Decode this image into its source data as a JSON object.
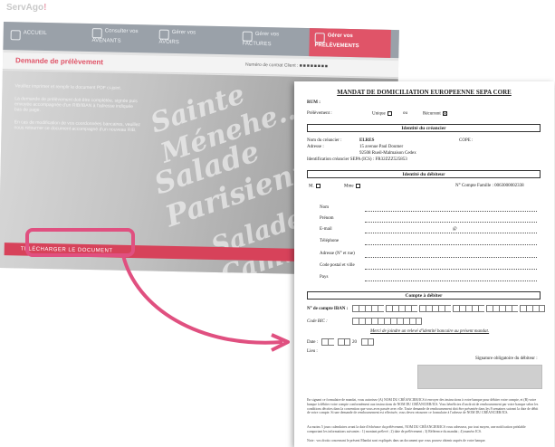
{
  "logo": {
    "text_left": "ServAgo",
    "text_accent": "!"
  },
  "app": {
    "nav": [
      {
        "label": "ACCUEIL",
        "icon": "home-icon"
      },
      {
        "label": "Consulter vos\nAVENANTS",
        "icon": "document-icon"
      },
      {
        "label": "Gérer vos\nAVOIRS",
        "icon": "list-icon"
      },
      {
        "label": "Gérer vos\nFACTURES",
        "icon": "invoice-icon"
      },
      {
        "label": "Gérer vos\nPRÉLÈVEMENTS",
        "icon": "card-icon",
        "active": true
      }
    ],
    "page_title": "Demande de prélèvement",
    "contract_label": "Numéro de contrat Client :",
    "contract_value": "■■■■■■■■",
    "content_lines": [
      "Veuillez imprimer et remplir le document PDF ci-joint.",
      "La demande de prélèvement doit être complétée, signée puis\nenvoyée accompagnée d'un RIB/IBAN à l'adresse indiquée\nbas de page.",
      "En cas de modification de vos coordonnées bancaires, veuillez\nnous retourner ce document accompagné d'un nouveau RIB."
    ],
    "brand_words": [
      "Sainte Ménehe...",
      "Salade Parisienne",
      "Salade Cam..."
    ],
    "download_button": "TÉLÉCHARGER LE DOCUMENT",
    "accent_color": "#e05468"
  },
  "doc": {
    "title": "MANDAT DE DOMICILIATION EUROPEENNE SEPA CORE",
    "rum_label": "RUM :",
    "prelevement_label": "Prélèvement :",
    "unique_label": "Unique",
    "ou_label": "ou",
    "recurrent_label": "Récurrent",
    "section_creancier": "Identité du créancier",
    "creancier_name_label": "Nom du créancier :",
    "creancier_name": "ELRES",
    "cope_label": "COPE :",
    "adresse_label": "Adresse :",
    "adresse_line1": "15 avenue Paul Doumer",
    "adresse_line2": "92508 Rueil-Malmaison Cedex",
    "ics_label": "Identification créancier SEPA (ICS) : FR32ZZZ525853",
    "section_debiteur": "Identité du débiteur",
    "m_label": "M.",
    "mme_label": "Mme",
    "compte_famille_label": "N° Compte Famille :",
    "compte_famille_value": "0063000002338",
    "fields": [
      "Nom",
      "Prénom",
      "E-mail",
      "Téléphone",
      "Adresse (N° et rue)",
      "Code postal et ville",
      "Pays"
    ],
    "at_sign": "@",
    "section_compte": "Compte à débiter",
    "iban_label": "N° de compte IBAN :",
    "bic_label": "Code BIC :",
    "rib_note": "Merci de joindre un relevé d'identité bancaire au présent mandat.",
    "date_label": "Date :",
    "date_year": "20",
    "lieu_label": "Lieu :",
    "signature_label": "Signature obligatoire du débiteur :",
    "fine_print_1": "En signant ce formulaire de mandat, vous autorisez (A) NOM DU CRÉANCIER/ICS à envoyer des instructions à votre banque pour débiter votre compte, et (B) votre banque à débiter votre compte conformément aux instructions de NOM DU CRÉANCIER/ICS. Vous bénéficiez d'un droit de remboursement par votre banque selon les conditions décrites dans la convention que vous avez passée avec elle. Toute demande de remboursement doit être présentée dans les 8 semaines suivant la date de débit de votre compte. Si une demande de remboursement est effectuée, vous devez retourner ce formulaire à l'adresse de NOM DU CRÉANCIER/ICS.",
    "fine_print_2": "Au moins 5 jours calendaires avant la date d'échéance du prélèvement, NOM DU CRÉANCIER/ICS vous adressera, par tout moyen, une notification préalable comportant les informations suivantes : 1) montant prélevé ; 2) date de prélèvement ; 3) Référence du mandat ; 4) numéro ICS.",
    "fine_print_3": "Note : vos droits concernant le présent Mandat sont expliqués dans un document que vous pouvez obtenir auprès de votre banque."
  }
}
